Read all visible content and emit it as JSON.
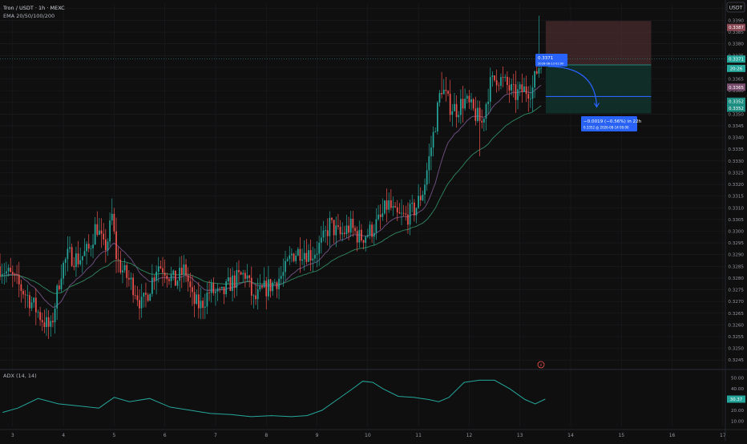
{
  "header": {
    "symbol_title": "Tron / USDT · 1h · MEXC",
    "indicator_label": "EMA 20/50/100/200",
    "currency": "USDT",
    "pane_label": "ADX (14, 14)"
  },
  "colors": {
    "background": "#0f0f0f",
    "up": "#26a69a",
    "down": "#ef5350",
    "ema_fast": "#6a4c7a",
    "ema_slow": "#2e7d5b",
    "adx": "#26a69a",
    "projection": "#2962ff",
    "risk_zone": "#4a2b2e",
    "reward_zone": "#12332b"
  },
  "price_axis": {
    "ticks": [
      "0.3395",
      "0.3390",
      "0.3385",
      "0.3380",
      "0.3375",
      "0.3370",
      "0.3365",
      "0.3360",
      "0.3355",
      "0.3350",
      "0.3345",
      "0.3340",
      "0.3335",
      "0.3330",
      "0.3325",
      "0.3320",
      "0.3315",
      "0.3310",
      "0.3305",
      "0.3300",
      "0.3295",
      "0.3290",
      "0.3285",
      "0.3280",
      "0.3275",
      "0.3270",
      "0.3265",
      "0.3260",
      "0.3255",
      "0.3250",
      "0.3245"
    ],
    "tags": [
      {
        "text": "0.3387",
        "kind": "risk",
        "price": 0.3387
      },
      {
        "text": "0.3371",
        "kind": "current",
        "price": 0.33735
      },
      {
        "text": "20:26",
        "kind": "countdown",
        "price": 0.33695
      },
      {
        "text": "0.3365",
        "kind": "ema",
        "price": 0.33615
      },
      {
        "text": "0.3352",
        "kind": "target",
        "price": 0.33555
      },
      {
        "text": "0.3352",
        "kind": "target",
        "price": 0.33525
      }
    ]
  },
  "time_axis": {
    "ticks": [
      "3",
      "4",
      "5",
      "6",
      "7",
      "8",
      "9",
      "10",
      "11",
      "12",
      "13",
      "14",
      "15",
      "16",
      "17"
    ]
  },
  "adx_axis": {
    "ticks": [
      "50.00",
      "40.00",
      "30.00",
      "20.00",
      "10.00"
    ],
    "current": "30.37"
  },
  "projection": {
    "entry_label": "0.3371",
    "entry_date": "2026-08-13 02:00",
    "change_label": "−0.0019 (−0.56%) in 22h",
    "target_label": "0.3352 @ 2026-08-14 00:00"
  },
  "chart_data": {
    "type": "candlestick",
    "x_unit": "day of month (hourly candles)",
    "ylim": [
      0.3242,
      0.3397
    ],
    "xlim": [
      2.75,
      17.05
    ],
    "candles": [],
    "ema_fast": [],
    "ema_slow": [],
    "adx": {
      "ylim": [
        5,
        55
      ],
      "x": [
        2.8,
        3.1,
        3.5,
        3.9,
        4.3,
        4.7,
        5.0,
        5.3,
        5.7,
        6.1,
        6.5,
        6.9,
        7.3,
        7.7,
        8.1,
        8.5,
        8.8,
        9.1,
        9.4,
        9.7,
        9.9,
        10.1,
        10.3,
        10.6,
        10.9,
        11.2,
        11.4,
        11.6,
        11.9,
        12.2,
        12.5,
        12.8,
        13.1,
        13.3,
        13.5
      ],
      "values": [
        18,
        22,
        31,
        26,
        24,
        22,
        32,
        28,
        31,
        23,
        20,
        17,
        16,
        14,
        15,
        14,
        15,
        20,
        30,
        40,
        47,
        46,
        40,
        33,
        32,
        30,
        28,
        32,
        46,
        48,
        48,
        40,
        30,
        26,
        30.37
      ]
    },
    "projection": {
      "entry": 0.3371,
      "target": 0.3352,
      "stop": 0.3387,
      "entry_x": 13.43,
      "target_x": 14.45
    }
  }
}
